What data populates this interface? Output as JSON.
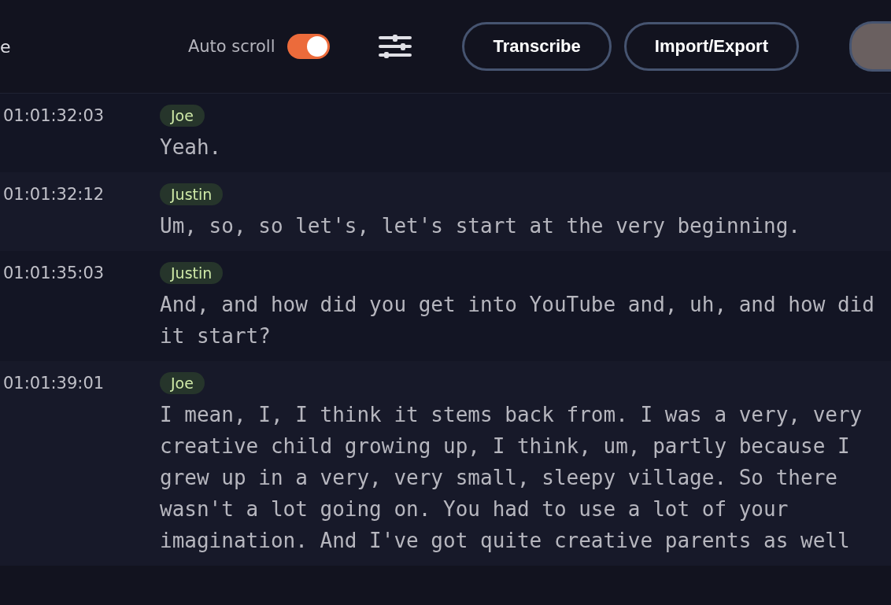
{
  "header": {
    "cut_title": "e",
    "auto_scroll": {
      "label": "Auto scroll",
      "on": true
    },
    "buttons": [
      "Transcribe",
      "Import/Export"
    ]
  },
  "segments": [
    {
      "time": "01:01:32:03",
      "speaker": "Joe",
      "text": "Yeah."
    },
    {
      "time": "01:01:32:12",
      "speaker": "Justin",
      "text": "Um, so, so let's, let's start at the very beginning."
    },
    {
      "time": "01:01:35:03",
      "speaker": "Justin",
      "text": "And, and how did you get into YouTube and, uh, and how did it start?"
    },
    {
      "time": "01:01:39:01",
      "speaker": "Joe",
      "text": "I mean, I, I think it stems back from. I was a very, very creative child growing up, I think, um, partly because I grew up in a very, very small, sleepy village. So there wasn't a lot going on. You had to use a lot of your imagination. And I've got quite creative parents as well"
    }
  ]
}
